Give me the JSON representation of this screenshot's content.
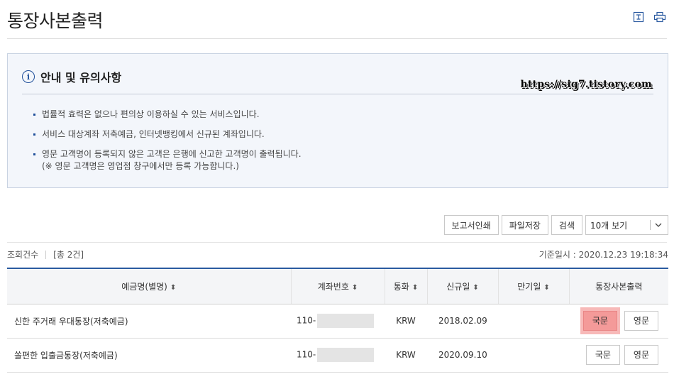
{
  "page": {
    "title": "통장사본출력",
    "icons": [
      "document-icon",
      "print-icon"
    ]
  },
  "notice": {
    "title": "안내 및 유의사항",
    "watermark": "https://sig7.tistory.com",
    "items": [
      "법률적 효력은 없으나 편의상 이용하실 수 있는 서비스입니다.",
      "서비스 대상계좌 저축예금, 인터넷뱅킹에서 신규된 계좌입니다.",
      "영문 고객명이 등록되지 않은 고객은 은행에 신고한 고객명이 출력됩니다."
    ],
    "item3_sub": "(※ 영문 고객명은 영업점 창구에서만 등록 가능합니다.)"
  },
  "toolbar": {
    "report_print": "보고서인쇄",
    "file_save": "파일저장",
    "search": "검색",
    "page_size": "10개 보기"
  },
  "meta": {
    "count_label": "조회건수",
    "count_value": "[총 2건]",
    "basedate": "기준일시 : 2020.12.23 19:18:34"
  },
  "table": {
    "headers": [
      "예금명(별명)",
      "계좌번호",
      "통화",
      "신규일",
      "만기일",
      "통장사본출력"
    ],
    "rows": [
      {
        "name": "신한 주거래 우대통장(저축예금)",
        "account": "110-",
        "currency": "KRW",
        "opened": "2018.02.09",
        "maturity": "",
        "btn_kr": "국문",
        "btn_en": "영문"
      },
      {
        "name": "쏠편한 입출금통장(저축예금)",
        "account": "110-",
        "currency": "KRW",
        "opened": "2020.09.10",
        "maturity": "",
        "btn_kr": "국문",
        "btn_en": "영문"
      }
    ]
  },
  "colors": {
    "accent": "#2a5aa0",
    "highlight": "#f49a99"
  }
}
